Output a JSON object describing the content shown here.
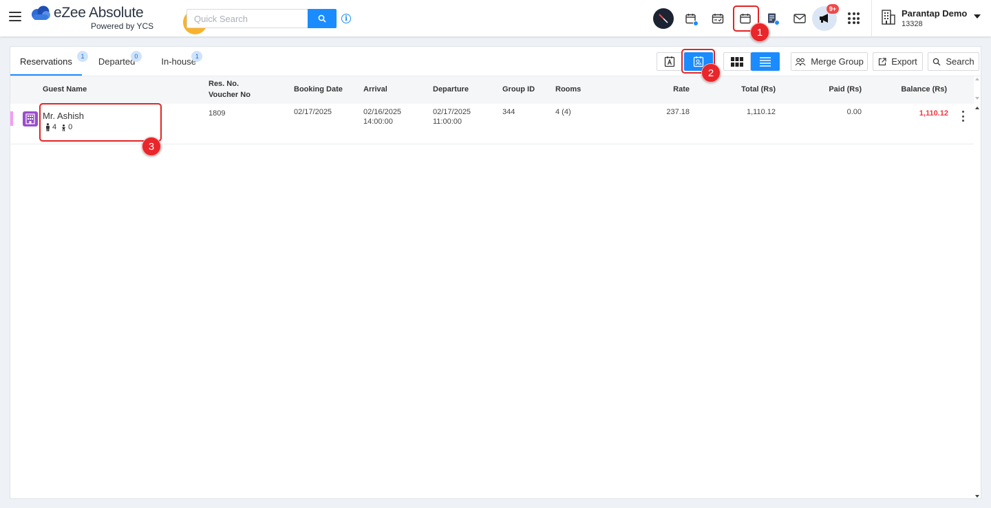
{
  "brand": {
    "name": "eZee Absolute",
    "tagline": "Powered by YCS",
    "logo_icon": "ezee-cloud-logo",
    "accent_color": "#f8b32b"
  },
  "topbar": {
    "search_placeholder": "Quick Search",
    "icons": [
      "menu-icon",
      "shuffle-icon",
      "search-icon",
      "info-icon",
      "dashboard-compass-icon",
      "calendar-add-icon",
      "calendar-check-icon",
      "calendar-icon",
      "report-billing-icon",
      "mail-icon",
      "megaphone-icon",
      "apps-grid-icon"
    ],
    "notification_badge": "9+"
  },
  "hotel": {
    "name": "Parantap Demo",
    "code": "13328"
  },
  "tabs": [
    {
      "label": "Reservations",
      "count": "1",
      "active": true
    },
    {
      "label": "Departed",
      "count": "0",
      "active": false
    },
    {
      "label": "In-house",
      "count": "1",
      "active": false
    }
  ],
  "toolbar": {
    "merge_group_label": "Merge Group",
    "export_label": "Export",
    "search_label": "Search"
  },
  "table": {
    "headers": {
      "guest_name": "Guest Name",
      "res_no": "Res. No.",
      "voucher_no": "Voucher No",
      "booking_date": "Booking Date",
      "arrival": "Arrival",
      "departure": "Departure",
      "group_id": "Group ID",
      "rooms": "Rooms",
      "rate": "Rate",
      "total": "Total (Rs)",
      "paid": "Paid (Rs)",
      "balance": "Balance (Rs)"
    },
    "rows": [
      {
        "guest_name": "Mr. Ashish",
        "adults": "4",
        "children": "0",
        "res_no": "1809",
        "booking_date": "02/17/2025",
        "arrival_date": "02/16/2025",
        "arrival_time": "14:00:00",
        "departure_date": "02/17/2025",
        "departure_time": "11:00:00",
        "group_id": "344",
        "rooms": "4 (4)",
        "rate": "237.18",
        "total": "1,110.12",
        "paid": "0.00",
        "balance": "1,110.12",
        "status_color": "#f39df5"
      }
    ]
  },
  "annotations": {
    "markers": [
      "1",
      "2",
      "3"
    ],
    "color": "#e8262b"
  }
}
